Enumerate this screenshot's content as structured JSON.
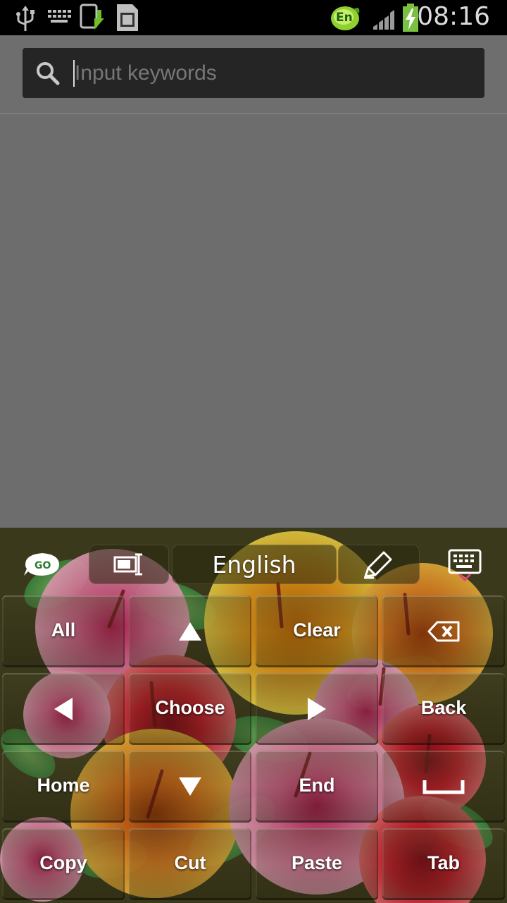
{
  "status_bar": {
    "time": "08:16",
    "language_badge": "En",
    "icons": [
      "usb-icon",
      "keyboard-notification-icon",
      "upload-icon",
      "sd-card-icon",
      "signal-icon",
      "battery-charging-icon"
    ]
  },
  "search": {
    "placeholder": "Input keywords",
    "value": "",
    "icon": "search-icon"
  },
  "keyboard": {
    "toolbar": {
      "logo_text": "GO",
      "language": "English",
      "icons": [
        "go-logo-icon",
        "layout-switch-icon",
        "pen-icon",
        "hide-keyboard-icon"
      ]
    },
    "rows": [
      [
        {
          "label": "All"
        },
        {
          "icon": "arrow-up-icon"
        },
        {
          "label": "Clear"
        },
        {
          "icon": "backspace-icon"
        }
      ],
      [
        {
          "icon": "arrow-left-icon"
        },
        {
          "label": "Choose"
        },
        {
          "icon": "arrow-right-icon"
        },
        {
          "label": "Back"
        }
      ],
      [
        {
          "label": "Home"
        },
        {
          "icon": "arrow-down-icon"
        },
        {
          "label": "End"
        },
        {
          "icon": "space-icon"
        }
      ],
      [
        {
          "label": "Copy"
        },
        {
          "label": "Cut"
        },
        {
          "label": "Paste"
        },
        {
          "label": "Tab"
        }
      ]
    ]
  }
}
